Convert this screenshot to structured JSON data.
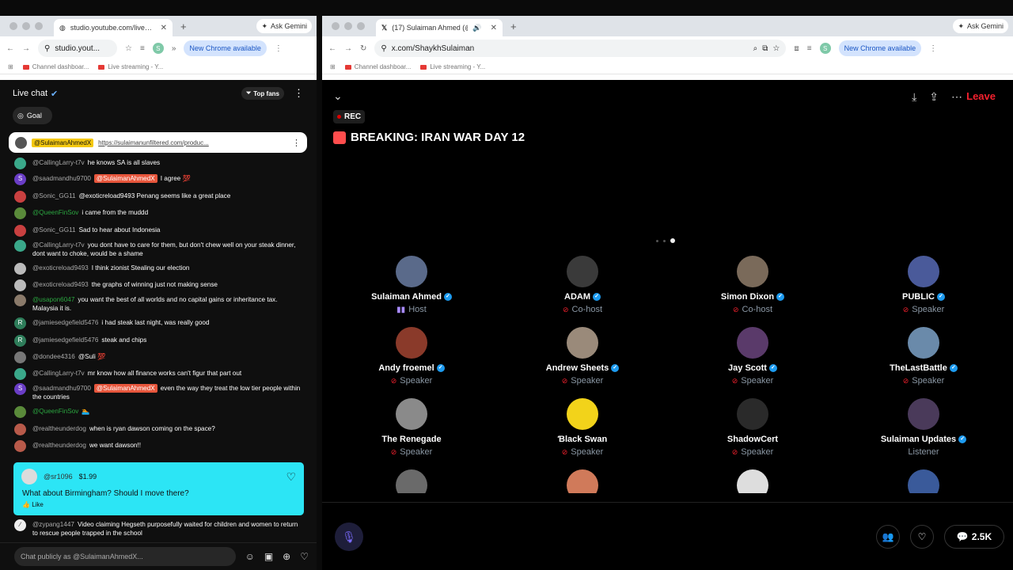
{
  "left_window": {
    "tab_title": "studio.youtube.com/live_chat",
    "url": "studio.yout...",
    "new_chrome": "New Chrome available",
    "ask_gemini": "Ask Gemini",
    "bookmarks": [
      "Channel dashboar...",
      "Live streaming - Y..."
    ],
    "profile_letter": "S"
  },
  "chat": {
    "title": "Live chat",
    "top_fans": "Top fans",
    "goal": "Goal",
    "pinned": {
      "mention": "@SulaimanAhmedX",
      "link": "https://sulaimanunfiltered.com/produc..."
    },
    "messages": [
      {
        "author": "@CallingLarry-t7v",
        "text": "he knows SA is all slaves",
        "avatar_color": "#3aa88a",
        "initial": ""
      },
      {
        "author": "@saadmandhu9700",
        "mention": "@SulaimanAhmedX",
        "text": "I agree 💯",
        "avatar_color": "#6a3dc6",
        "initial": "S"
      },
      {
        "author": "@Sonic_GG11",
        "text": "@exoticreload9493 Penang seems like a great place",
        "avatar_color": "#c94040",
        "initial": ""
      },
      {
        "author": "@QueenFinSov",
        "text": "i came from the muddd",
        "avatar_color": "#5a8a3a",
        "initial": "",
        "green": true
      },
      {
        "author": "@Sonic_GG11",
        "text": "Sad to hear about Indonesia",
        "avatar_color": "#c94040",
        "initial": ""
      },
      {
        "author": "@CallingLarry-t7v",
        "text": "you dont have to care for them, but don't chew well on your steak dinner, dont want to choke, would be a shame",
        "avatar_color": "#3aa88a",
        "initial": ""
      },
      {
        "author": "@exoticreload9493",
        "text": "I think zionist Stealing our election",
        "avatar_color": "#bbbbbb",
        "initial": ""
      },
      {
        "author": "@exoticreload9493",
        "text": "the graphs of winning just not making sense",
        "avatar_color": "#bbbbbb",
        "initial": ""
      },
      {
        "author": "@usapon6047",
        "text": "you want the best of all worlds and no capital gains or inheritance tax. Malaysia it is.",
        "avatar_color": "#8a7a6a",
        "initial": "",
        "green": true
      },
      {
        "author": "@jamiesedgefield5476",
        "text": "i had steak last night, was really good",
        "avatar_color": "#2e7d5a",
        "initial": "R"
      },
      {
        "author": "@jamiesedgefield5476",
        "text": "steak and chips",
        "avatar_color": "#2e7d5a",
        "initial": "R"
      },
      {
        "author": "@dondee4316",
        "text": "@Suli 💯",
        "avatar_color": "#777777",
        "initial": ""
      },
      {
        "author": "@CallingLarry-t7v",
        "text": "mr know how all finance works can't figur that part out",
        "avatar_color": "#3aa88a",
        "initial": ""
      },
      {
        "author": "@saadmandhu9700",
        "mention": "@SulaimanAhmedX",
        "text": "even the way they treat the low tier people within the countries",
        "avatar_color": "#6a3dc6",
        "initial": "S"
      },
      {
        "author": "@QueenFinSov",
        "text": "🏊",
        "avatar_color": "#5a8a3a",
        "initial": "",
        "green": true
      },
      {
        "author": "@realtheunderdog",
        "text": "when is ryan dawson coming on the space?",
        "avatar_color": "#b85a4a",
        "initial": ""
      },
      {
        "author": "@realtheunderdog",
        "text": "we want dawson!!",
        "avatar_color": "#b85a4a",
        "initial": ""
      }
    ],
    "superchat": {
      "author": "@sr1096",
      "amount": "$1.99",
      "text": "What about Birmingham? Should I move there?",
      "like": "Like"
    },
    "last_message": {
      "author": "@zypang1447",
      "text": "Video claiming Hegseth purposefully waited for children and women to return to rescue people trapped in the school"
    },
    "input_placeholder": "Chat publicly as @SulaimanAhmedX..."
  },
  "right_window": {
    "tab_title": "(17) Sulaiman Ahmed (@S",
    "url": "x.com/ShaykhSulaiman",
    "new_chrome": "New Chrome available",
    "ask_gemini": "Ask Gemini",
    "bookmarks": [
      "Channel dashboar...",
      "Live streaming - Y..."
    ],
    "profile_letter": "S"
  },
  "space": {
    "rec": "REC",
    "title": "BREAKING: IRAN WAR DAY 12",
    "leave": "Leave",
    "listener_count": "2.5K",
    "participants": [
      {
        "name": "Sulaiman Ahmed",
        "role": "Host",
        "verified": true,
        "color": "#5a6a8a"
      },
      {
        "name": "ADAM",
        "role": "Co-host",
        "verified": true,
        "color": "#3a3a3a"
      },
      {
        "name": "Simon Dixon",
        "role": "Co-host",
        "verified": true,
        "color": "#7a6a5a"
      },
      {
        "name": "PUBLIC",
        "role": "Speaker",
        "verified": true,
        "color": "#4a5a9a"
      },
      {
        "name": "Andy froemel",
        "role": "Speaker",
        "verified": true,
        "color": "#8a3a2a"
      },
      {
        "name": "Andrew Sheets",
        "role": "Speaker",
        "verified": true,
        "color": "#9a8a7a"
      },
      {
        "name": "Jay Scott",
        "role": "Speaker",
        "verified": true,
        "color": "#5a3a6a"
      },
      {
        "name": "TheLastBattle",
        "role": "Speaker",
        "verified": true,
        "color": "#6a8aaa"
      },
      {
        "name": "The Renegade",
        "role": "Speaker",
        "verified": false,
        "color": "#8a8a8a"
      },
      {
        "name": "Ɓlack Swan",
        "role": "Speaker",
        "verified": false,
        "color": "#f2d31a"
      },
      {
        "name": "ShadowCert",
        "role": "Speaker",
        "verified": false,
        "color": "#2a2a2a"
      },
      {
        "name": "Sulaiman Updates",
        "role": "Listener",
        "verified": true,
        "color": "#4a3a5a"
      }
    ],
    "partial_row_colors": [
      "#6a6a6a",
      "#d07a5a",
      "#dddddd",
      "#3a5a9a"
    ]
  }
}
